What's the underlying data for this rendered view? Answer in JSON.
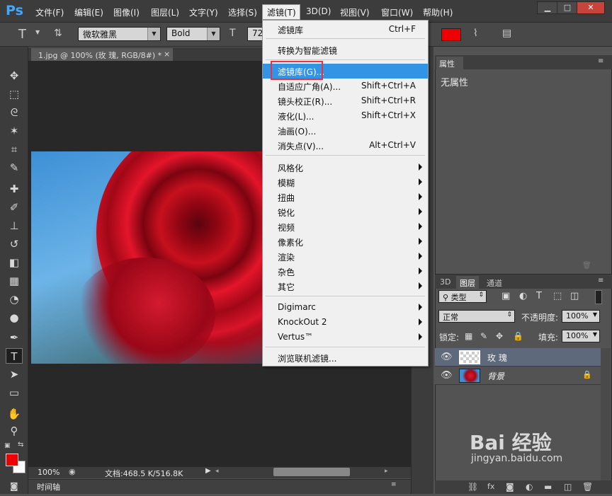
{
  "app": {
    "logo": "Ps"
  },
  "menubar": [
    "文件(F)",
    "编辑(E)",
    "图像(I)",
    "图层(L)",
    "文字(Y)",
    "选择(S)",
    "滤镜(T)",
    "3D(D)",
    "视图(V)",
    "窗口(W)",
    "帮助(H)"
  ],
  "options": {
    "font_family": "微软雅黑",
    "font_style": "Bold",
    "font_size": "72"
  },
  "document": {
    "tab_title": "1.jpg @ 100% (玫 瑰, RGB/8#) *",
    "tab_close": "×",
    "zoom": "100%",
    "doc_info": "文档:468.5 K/516.8K",
    "timeline": "时间轴"
  },
  "properties": {
    "tab": "属性",
    "empty_text": "无属性"
  },
  "layers": {
    "tabs": [
      "3D",
      "图层",
      "通道"
    ],
    "filter_kind": "类型",
    "blend_mode": "正常",
    "opacity_label": "不透明度:",
    "opacity_value": "100%",
    "lock_label": "锁定:",
    "fill_label": "填充:",
    "fill_value": "100%",
    "items": [
      {
        "name": "玫 瑰"
      },
      {
        "name": "背景"
      }
    ]
  },
  "filter_menu": {
    "last_filter": {
      "label": "滤镜库",
      "shortcut": "Ctrl+F"
    },
    "convert": "转换为智能滤镜",
    "items": [
      {
        "label": "滤镜库(G)...",
        "shortcut": ""
      },
      {
        "label": "自适应广角(A)...",
        "shortcut": "Shift+Ctrl+A"
      },
      {
        "label": "镜头校正(R)...",
        "shortcut": "Shift+Ctrl+R"
      },
      {
        "label": "液化(L)...",
        "shortcut": "Shift+Ctrl+X"
      },
      {
        "label": "油画(O)...",
        "shortcut": ""
      },
      {
        "label": "消失点(V)...",
        "shortcut": "Alt+Ctrl+V"
      }
    ],
    "submenus": [
      "风格化",
      "模糊",
      "扭曲",
      "锐化",
      "视频",
      "像素化",
      "渲染",
      "杂色",
      "其它"
    ],
    "plugins": [
      "Digimarc",
      "KnockOut 2",
      "Vertus™"
    ],
    "browse": "浏览联机滤镜..."
  },
  "watermark": {
    "brand": "Bai 经验",
    "url": "jingyan.baidu.com"
  },
  "colors": {
    "foreground": "#ef0000",
    "background": "#ffffff",
    "menu_highlight": "#3394e6",
    "annotation_box": "#e8333a"
  }
}
